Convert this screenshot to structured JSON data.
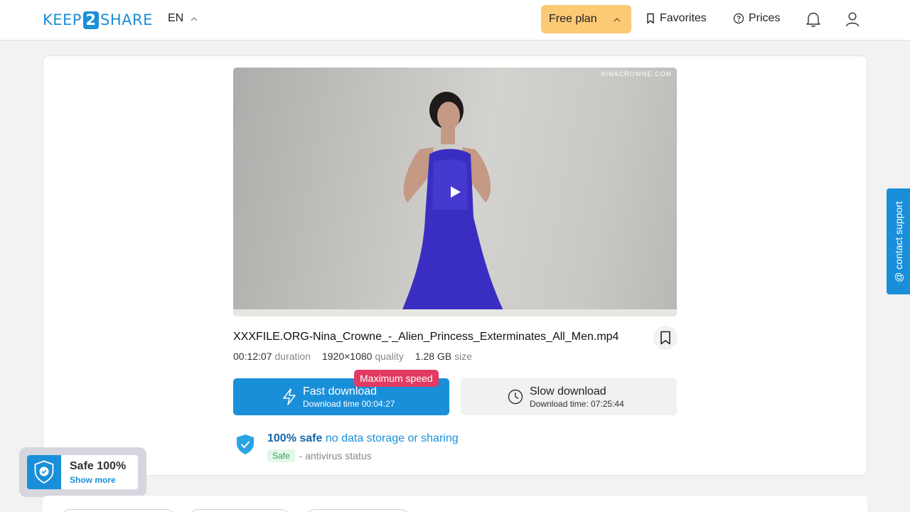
{
  "header": {
    "logo_left": "KEEP",
    "logo_mid": "2",
    "logo_right": "SHARE",
    "language": "EN",
    "plan_label": "Free plan",
    "favorites_label": "Favorites",
    "prices_label": "Prices"
  },
  "video": {
    "watermark": "NINACROWNE.COM"
  },
  "file": {
    "name": "XXXFILE.ORG-Nina_Crowne_-_Alien_Princess_Exterminates_All_Men.mp4",
    "duration": "00:12:07",
    "duration_label": "duration",
    "resolution": "1920×1080",
    "quality_label": "quality",
    "size": "1.28 GB",
    "size_label": "size"
  },
  "download": {
    "badge": "Maximum speed",
    "fast_title": "Fast download",
    "fast_time": "Download time 00:04:27",
    "slow_title": "Slow download",
    "slow_time": "Download time: 07:25:44"
  },
  "safety": {
    "headline_bold": "100% safe",
    "headline_rest": "no data storage or sharing",
    "tag": "Safe",
    "status_text": "- antivirus status"
  },
  "widget": {
    "title": "Safe 100%",
    "link": "Show more"
  },
  "support": {
    "label": "@ contact support"
  },
  "colors": {
    "accent": "#1a8fd9",
    "plan": "#fcc975",
    "badge": "#e23a63"
  }
}
